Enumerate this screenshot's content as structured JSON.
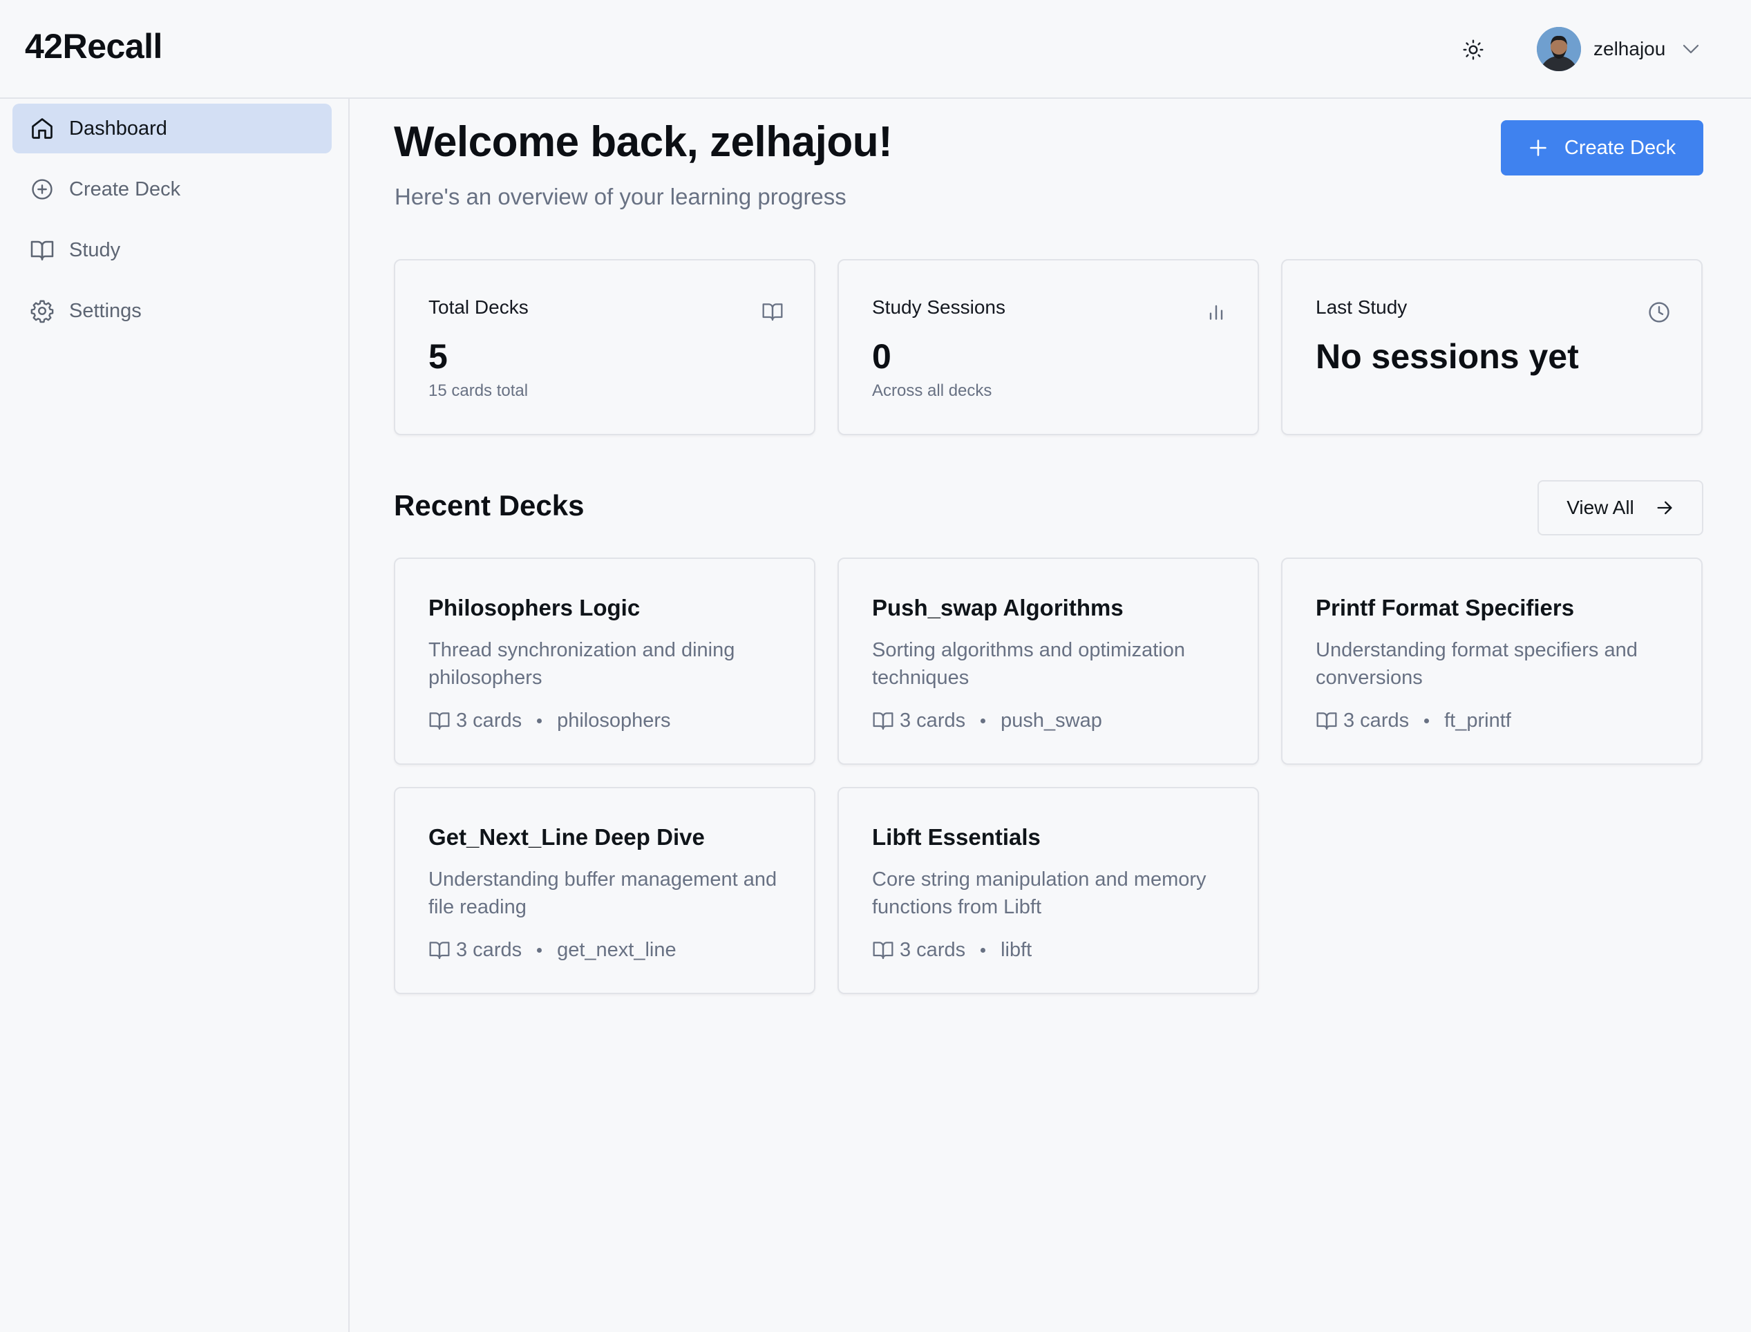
{
  "app": {
    "title": "42Recall"
  },
  "user": {
    "name": "zelhajou"
  },
  "sidebar": {
    "items": [
      {
        "label": "Dashboard",
        "icon": "home-icon",
        "active": true
      },
      {
        "label": "Create Deck",
        "icon": "plus-circle-icon",
        "active": false
      },
      {
        "label": "Study",
        "icon": "book-open-icon",
        "active": false
      },
      {
        "label": "Settings",
        "icon": "gear-icon",
        "active": false
      }
    ]
  },
  "main": {
    "welcome": "Welcome back, zelhajou!",
    "subtitle": "Here's an overview of your learning progress",
    "create_button": "Create Deck",
    "stats": [
      {
        "title": "Total Decks",
        "value": "5",
        "sub": "15 cards total",
        "icon": "book-open-icon"
      },
      {
        "title": "Study Sessions",
        "value": "0",
        "sub": "Across all decks",
        "icon": "bar-chart-icon"
      },
      {
        "title": "Last Study",
        "value": "No sessions yet",
        "sub": "",
        "icon": "clock-icon"
      }
    ],
    "recent_title": "Recent Decks",
    "view_all": "View All",
    "decks": [
      {
        "title": "Philosophers Logic",
        "desc": "Thread synchronization and dining philosophers",
        "cards": "3 cards",
        "tag": "philosophers"
      },
      {
        "title": "Push_swap Algorithms",
        "desc": "Sorting algorithms and optimization techniques",
        "cards": "3 cards",
        "tag": "push_swap"
      },
      {
        "title": "Printf Format Specifiers",
        "desc": "Understanding format specifiers and conversions",
        "cards": "3 cards",
        "tag": "ft_printf"
      },
      {
        "title": "Get_Next_Line Deep Dive",
        "desc": "Understanding buffer management and file reading",
        "cards": "3 cards",
        "tag": "get_next_line"
      },
      {
        "title": "Libft Essentials",
        "desc": "Core string manipulation and memory functions from Libft",
        "cards": "3 cards",
        "tag": "libft"
      }
    ]
  },
  "colors": {
    "accent": "#3f82ef",
    "active_nav_bg": "#d3dff4",
    "background": "#f7f8fa",
    "border": "#e1e3e8",
    "muted_text": "#687183"
  }
}
